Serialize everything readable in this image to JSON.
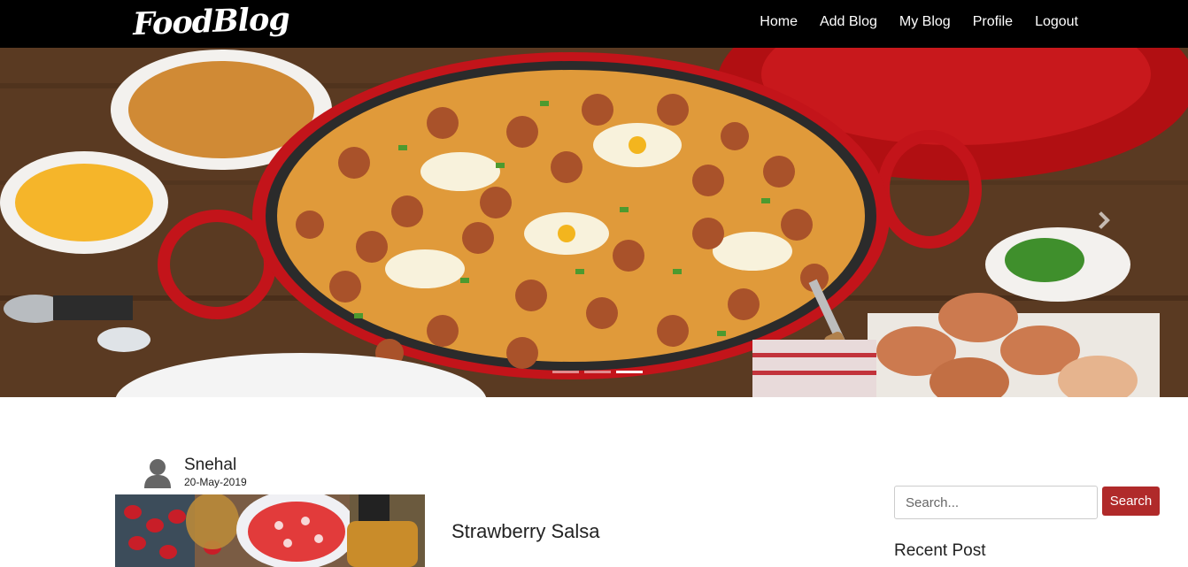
{
  "brand": "FoodBlog",
  "nav": {
    "items": [
      {
        "label": "Home"
      },
      {
        "label": "Add Blog"
      },
      {
        "label": "My Blog"
      },
      {
        "label": "Profile"
      },
      {
        "label": "Logout"
      }
    ]
  },
  "carousel": {
    "slide_count": 3,
    "active_index": 2,
    "next_icon": "chevron-right-icon"
  },
  "post": {
    "author": "Snehal",
    "date": "20-May-2019",
    "title": "Strawberry Salsa",
    "avatar_icon": "user-icon"
  },
  "sidebar": {
    "search_placeholder": "Search...",
    "search_button": "Search",
    "recent_heading": "Recent Post"
  },
  "colors": {
    "navbar_bg": "#000000",
    "accent": "#b02a2a"
  }
}
